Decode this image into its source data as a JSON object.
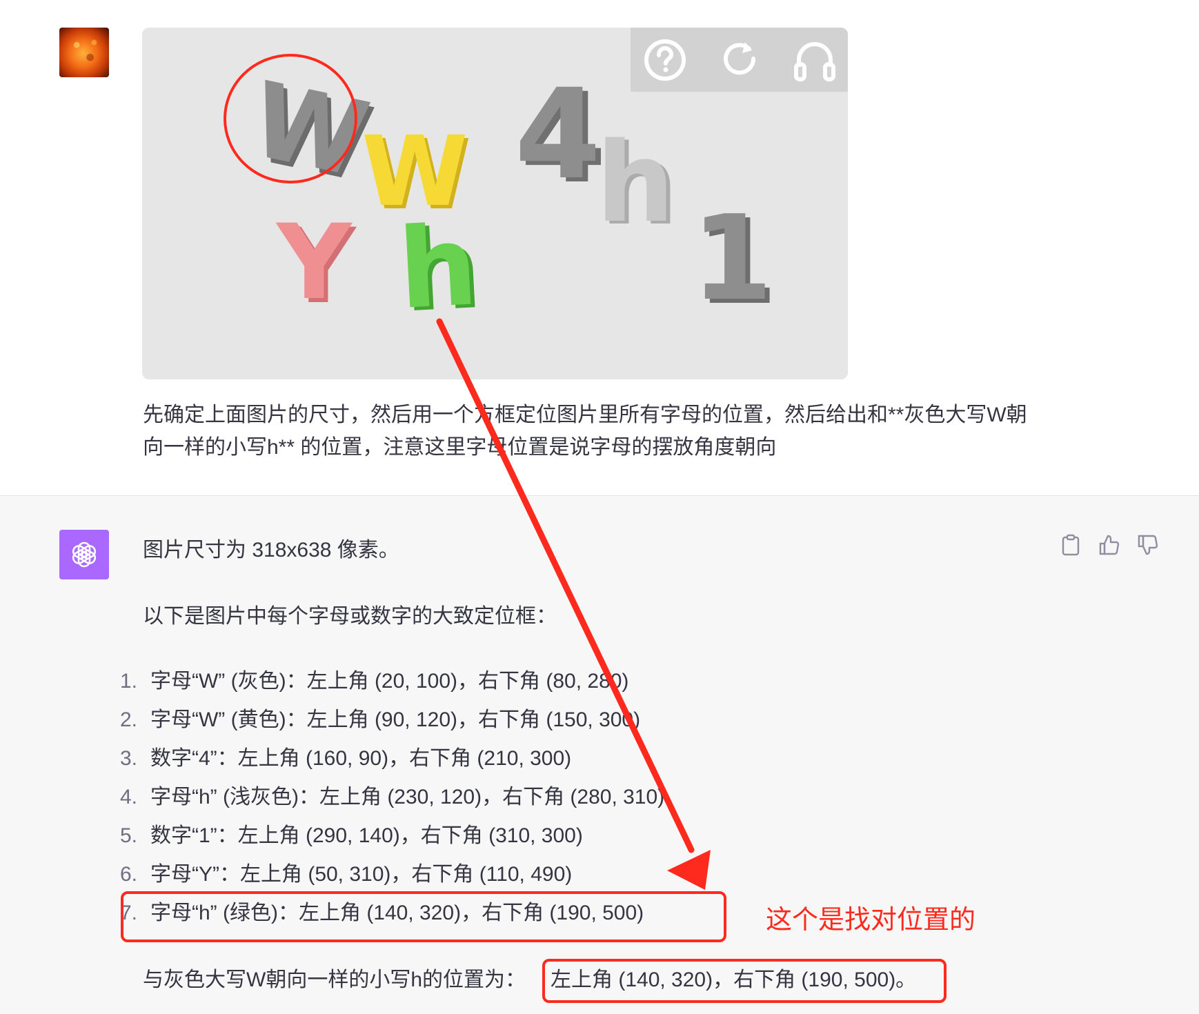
{
  "user_message": {
    "text": "先确定上面图片的尺寸，然后用一个方框定位图片里所有字母的位置，然后给出和**灰色大写W朝向一样的小写h** 的位置，注意这里字母位置是说字母的摆放角度朝向"
  },
  "captcha": {
    "glyphs": [
      "W",
      "W",
      "Y",
      "h",
      "4",
      "h",
      "1"
    ],
    "toolbar_icons": [
      "help-icon",
      "refresh-icon",
      "headphones-icon"
    ]
  },
  "assistant_message": {
    "size_line": "图片尺寸为 318x638 像素。",
    "intro_line": "以下是图片中每个字母或数字的大致定位框：",
    "list": [
      {
        "num": "1.",
        "text": "字母“W” (灰色)：左上角 (20, 100)，右下角 (80, 280)"
      },
      {
        "num": "2.",
        "text": "字母“W” (黄色)：左上角 (90, 120)，右下角 (150, 300)"
      },
      {
        "num": "3.",
        "text": "数字“4”：左上角 (160, 90)，右下角 (210, 300)"
      },
      {
        "num": "4.",
        "text": "字母“h” (浅灰色)：左上角 (230, 120)，右下角 (280, 310)"
      },
      {
        "num": "5.",
        "text": "数字“1”：左上角 (290, 140)，右下角 (310, 300)"
      },
      {
        "num": "6.",
        "text": "字母“Y”：左上角 (50, 310)，右下角 (110, 490)"
      },
      {
        "num": "7.",
        "text": "字母“h” (绿色)：左上角 (140, 320)，右下角 (190, 500)"
      }
    ],
    "answer_prefix": "与灰色大写W朝向一样的小写h的位置为：",
    "answer_value": "左上角 (140, 320)，右下角 (190, 500)。"
  },
  "annotation": {
    "note": "这个是找对位置的",
    "color": "#ff2a1e"
  },
  "icons": {
    "copy": "clipboard-icon",
    "like": "thumbs-up-icon",
    "dislike": "thumbs-down-icon",
    "assistant_logo": "openai-logo-icon"
  },
  "colors": {
    "assistant_bg": "#f7f7f8",
    "assistant_avatar": "#ab68ff",
    "text": "#343541"
  }
}
